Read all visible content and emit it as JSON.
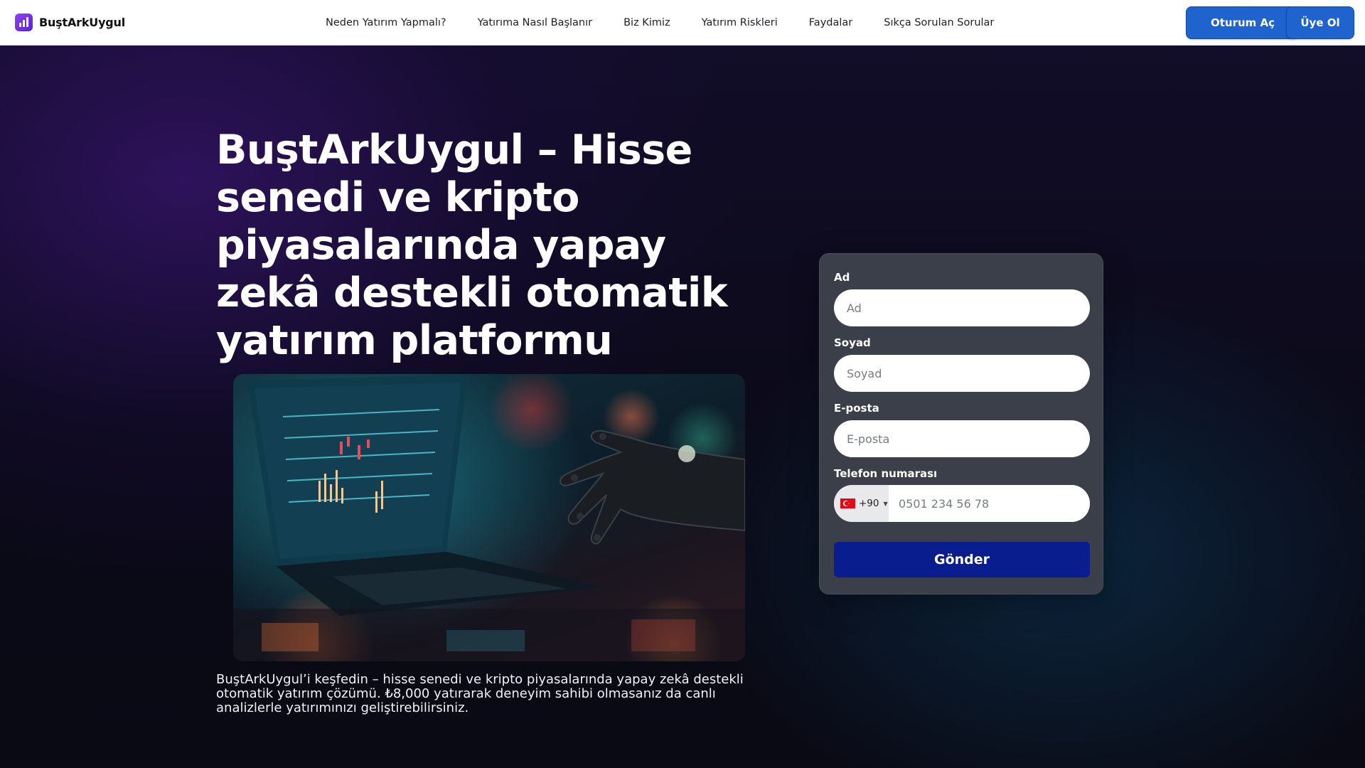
{
  "header": {
    "brand_name": "BuştArkUygul",
    "logo_icon": "bar-chart-icon",
    "nav": [
      {
        "label": "Neden Yatırım Yapmalı?"
      },
      {
        "label": "Yatırıma Nasıl Başlanır"
      },
      {
        "label": "Biz Kimiz"
      },
      {
        "label": "Yatırım Riskleri"
      },
      {
        "label": "Faydalar"
      },
      {
        "label": "Sıkça Sorulan Sorular"
      }
    ],
    "login_label": "Oturum Aç",
    "register_label": "Üye Ol"
  },
  "hero": {
    "headline": "BuştArkUygul – Hisse senedi ve kripto piyasalarında yapay zekâ destekli otomatik yatırım platformu",
    "description": "BuştArkUygul’i keşfedin – hisse senedi ve kripto piyasalarında yapay zekâ destekli otomatik yatırım çözümü. ₺8,000 yatırarak deneyim sahibi olmasanız da canlı analizlerle yatırımınızı geliştirebilirsiniz."
  },
  "form": {
    "first_name": {
      "label": "Ad",
      "placeholder": "Ad",
      "value": ""
    },
    "last_name": {
      "label": "Soyad",
      "placeholder": "Soyad",
      "value": ""
    },
    "email": {
      "label": "E-posta",
      "placeholder": "E-posta",
      "value": ""
    },
    "phone": {
      "label": "Telefon numarası",
      "dial_code": "+90",
      "country_flag": "turkey-flag-icon",
      "placeholder": "0501 234 56 78",
      "value": ""
    },
    "submit_label": "Gönder"
  },
  "colors": {
    "primary_button": "#1f63cf",
    "submit_button": "#0a1d8f",
    "card_background": "#3a3f49",
    "brand_logo": "#7b3fe4"
  }
}
